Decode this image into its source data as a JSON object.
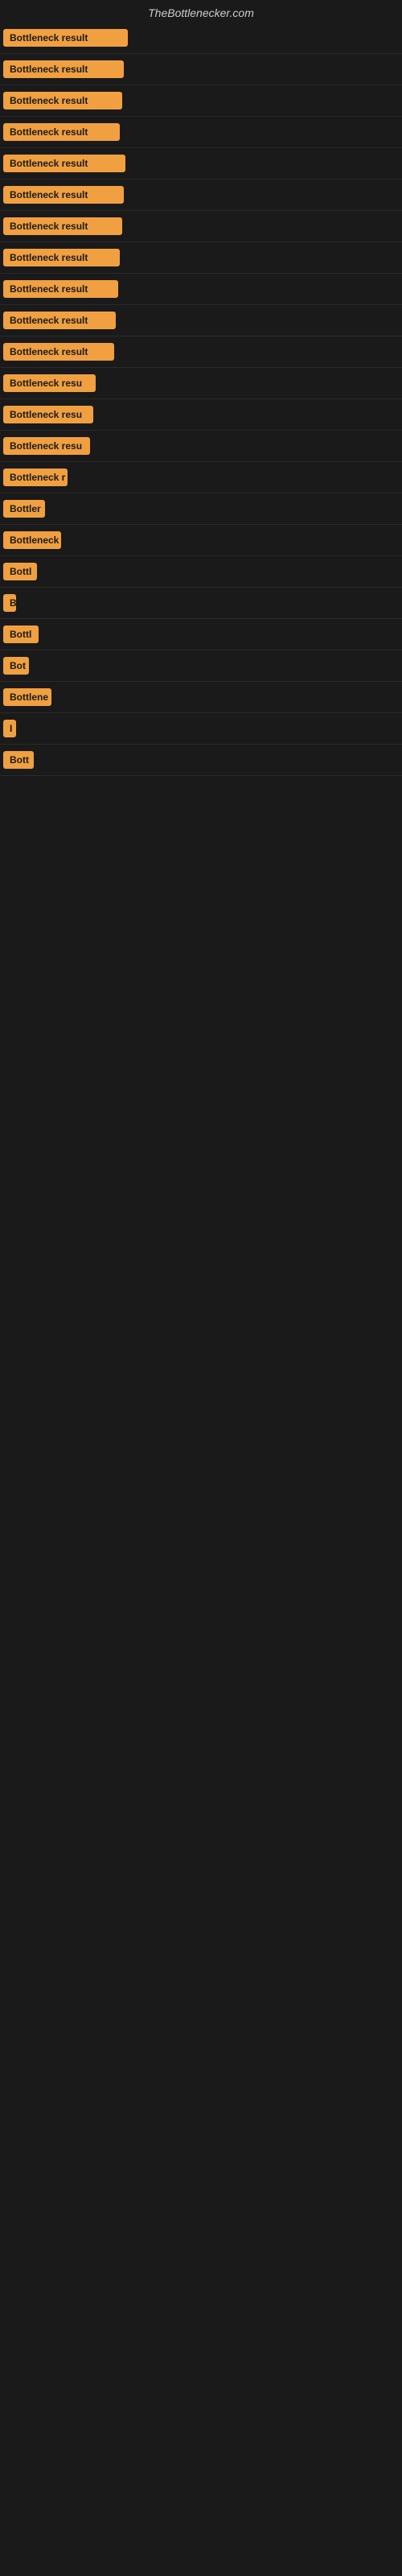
{
  "site": {
    "title": "TheBottlenecker.com"
  },
  "rows": [
    {
      "id": 1,
      "label": "Bottleneck result",
      "width": 155
    },
    {
      "id": 2,
      "label": "Bottleneck result",
      "width": 150
    },
    {
      "id": 3,
      "label": "Bottleneck result",
      "width": 148
    },
    {
      "id": 4,
      "label": "Bottleneck result",
      "width": 145
    },
    {
      "id": 5,
      "label": "Bottleneck result",
      "width": 152
    },
    {
      "id": 6,
      "label": "Bottleneck result",
      "width": 150
    },
    {
      "id": 7,
      "label": "Bottleneck result",
      "width": 148
    },
    {
      "id": 8,
      "label": "Bottleneck result",
      "width": 145
    },
    {
      "id": 9,
      "label": "Bottleneck result",
      "width": 143
    },
    {
      "id": 10,
      "label": "Bottleneck result",
      "width": 140
    },
    {
      "id": 11,
      "label": "Bottleneck result",
      "width": 138
    },
    {
      "id": 12,
      "label": "Bottleneck resu",
      "width": 115
    },
    {
      "id": 13,
      "label": "Bottleneck resu",
      "width": 112
    },
    {
      "id": 14,
      "label": "Bottleneck resu",
      "width": 108
    },
    {
      "id": 15,
      "label": "Bottleneck r",
      "width": 80
    },
    {
      "id": 16,
      "label": "Bottler",
      "width": 52
    },
    {
      "id": 17,
      "label": "Bottleneck",
      "width": 72
    },
    {
      "id": 18,
      "label": "Bottl",
      "width": 42
    },
    {
      "id": 19,
      "label": "B",
      "width": 14
    },
    {
      "id": 20,
      "label": "Bottl",
      "width": 44
    },
    {
      "id": 21,
      "label": "Bot",
      "width": 32
    },
    {
      "id": 22,
      "label": "Bottlene",
      "width": 60
    },
    {
      "id": 23,
      "label": "I",
      "width": 10
    },
    {
      "id": 24,
      "label": "Bott",
      "width": 38
    }
  ]
}
